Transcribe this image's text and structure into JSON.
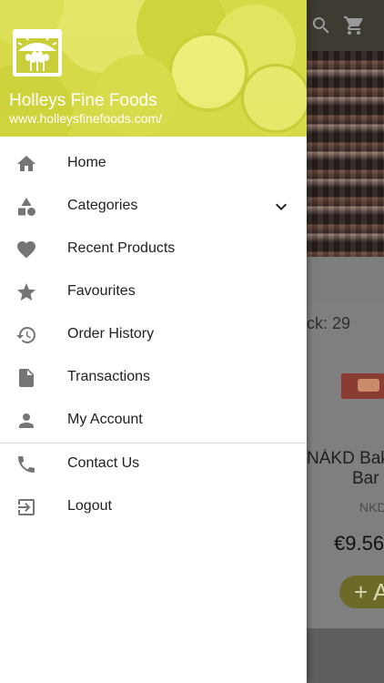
{
  "brand": {
    "name": "Holleys Fine Foods",
    "url": "www.holleysfinefoods.com/"
  },
  "menu": {
    "items": [
      {
        "label": "Home",
        "icon": "home-icon"
      },
      {
        "label": "Categories",
        "icon": "category-shapes-icon"
      },
      {
        "label": "Recent Products",
        "icon": "heart-icon"
      },
      {
        "label": "Favourites",
        "icon": "star-icon"
      },
      {
        "label": "Order History",
        "icon": "history-icon"
      },
      {
        "label": "Transactions",
        "icon": "document-icon"
      },
      {
        "label": "My Account",
        "icon": "person-icon"
      }
    ],
    "secondary": [
      {
        "label": "Contact Us",
        "icon": "phone-icon"
      },
      {
        "label": "Logout",
        "icon": "logout-icon"
      }
    ]
  },
  "background": {
    "stock_text": "ck: 29",
    "product_title_line1": "NÁKD Bak",
    "product_title_line2": "Bar",
    "product_brand": "NKD",
    "price": "€9.56",
    "add_button": "+ A"
  },
  "colors": {
    "header": "#d6da49",
    "icon": "#757575",
    "text": "#212121",
    "appbar": "#3d3b32",
    "add_button": "#6b6a28"
  }
}
